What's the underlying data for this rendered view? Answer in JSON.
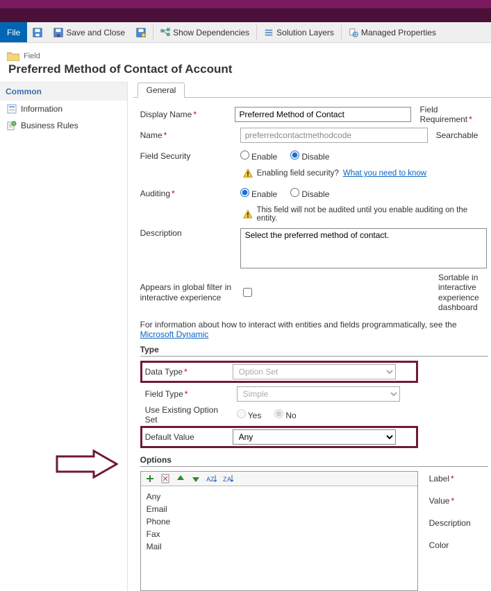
{
  "ribbon": {
    "file": "File",
    "save_and_close": "Save and Close",
    "show_dependencies": "Show Dependencies",
    "solution_layers": "Solution Layers",
    "managed_properties": "Managed Properties"
  },
  "header": {
    "kind": "Field",
    "title": "Preferred Method of Contact of Account"
  },
  "sidebar": {
    "heading": "Common",
    "items": [
      {
        "label": "Information"
      },
      {
        "label": "Business Rules"
      }
    ]
  },
  "tabs": [
    {
      "label": "General"
    }
  ],
  "form": {
    "display_name_label": "Display Name",
    "display_name_value": "Preferred Method of Contact",
    "field_requirement_label": "Field Requirement",
    "name_label": "Name",
    "name_value": "preferredcontactmethodcode",
    "searchable_label": "Searchable",
    "field_security_label": "Field Security",
    "enable_label": "Enable",
    "disable_label": "Disable",
    "field_security_selected": "disable",
    "fs_warning_text": "Enabling field security?",
    "fs_warning_link": "What you need to know",
    "auditing_label": "Auditing",
    "auditing_selected": "enable",
    "audit_warning": "This field will not be audited until you enable auditing on the entity.",
    "description_label": "Description",
    "description_value": "Select the preferred method of contact.",
    "global_filter_label": "Appears in global filter in interactive experience",
    "sortable_label": "Sortable in interactive experience dashboard",
    "info_line_prefix": "For information about how to interact with entities and fields programmatically, see the ",
    "info_line_link": "Microsoft Dynamic"
  },
  "type_section": {
    "heading": "Type",
    "data_type_label": "Data Type",
    "data_type_value": "Option Set",
    "field_type_label": "Field Type",
    "field_type_value": "Simple",
    "use_existing_label": "Use Existing Option Set",
    "yes_label": "Yes",
    "no_label": "No",
    "use_existing_selected": "no",
    "default_value_label": "Default Value",
    "default_value_value": "Any"
  },
  "options_section": {
    "heading": "Options",
    "items": [
      "Any",
      "Email",
      "Phone",
      "Fax",
      "Mail"
    ],
    "side": {
      "label": "Label",
      "value": "Value",
      "description": "Description",
      "color": "Color"
    }
  }
}
